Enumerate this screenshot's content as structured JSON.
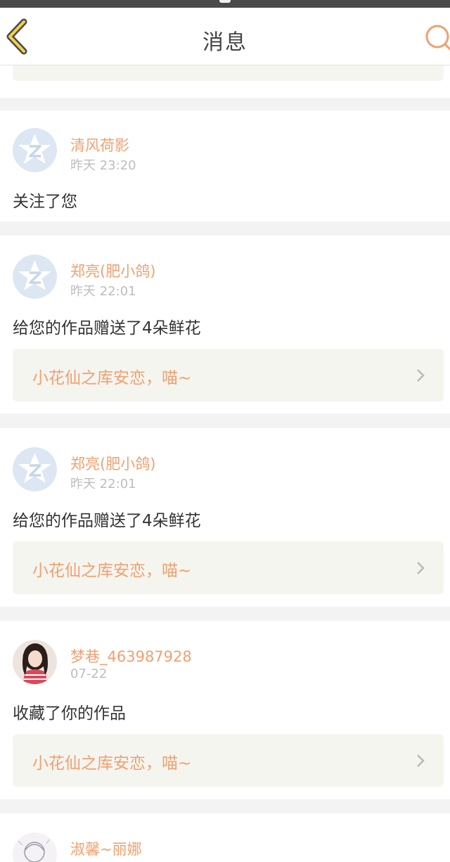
{
  "header": {
    "title": "消息",
    "back_icon": "chevron-left-icon",
    "search_icon": "search-icon",
    "accent": "#f0a070"
  },
  "messages": [
    {
      "name": "清风荷影",
      "time": "昨天 23:20",
      "action": "关注了您",
      "avatar": "qzone-default-avatar"
    },
    {
      "name": "郑亮(肥小鸽)",
      "time": "昨天 22:01",
      "action": "给您的作品赠送了4朵鲜花",
      "work": "小花仙之库安恋，喵~",
      "avatar": "qzone-default-avatar"
    },
    {
      "name": "郑亮(肥小鸽)",
      "time": "昨天 22:01",
      "action": "给您的作品赠送了4朵鲜花",
      "work": "小花仙之库安恋，喵~",
      "avatar": "qzone-default-avatar"
    },
    {
      "name": "梦巷_463987928",
      "time": "07-22",
      "action": "收藏了你的作品",
      "work": "小花仙之库安恋，喵~",
      "avatar": "user-photo-avatar"
    },
    {
      "name": "淑馨~丽娜",
      "avatar": "user-drawing-avatar"
    }
  ]
}
